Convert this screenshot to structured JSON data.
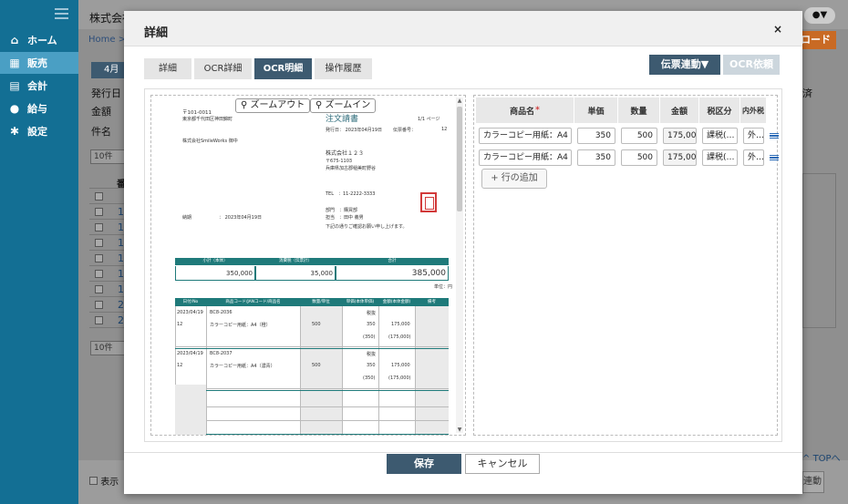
{
  "app": {
    "company": "株式会社",
    "breadcrumb_home": "Home",
    "breadcrumb_sep": ">",
    "download_label": "ロード",
    "user_caret": "▼",
    "sidebar": [
      {
        "icon": "home-icon",
        "label": "ホーム"
      },
      {
        "icon": "cart-icon",
        "label": "販売"
      },
      {
        "icon": "calculator-icon",
        "label": "会計"
      },
      {
        "icon": "money-bag-icon",
        "label": "給与"
      },
      {
        "icon": "gear-icon",
        "label": "設定"
      }
    ],
    "bg_tab": "4月",
    "bg_labels": [
      "発行日",
      "金額",
      "件名"
    ],
    "bg_page_size": "10件",
    "bg_status": "済",
    "bg_rows": [
      "",
      "1",
      "1",
      "1",
      "1",
      "1",
      "1",
      "2",
      "2"
    ],
    "bg_col_header": "番",
    "top_link": "TOPへ",
    "bg_show_label": "表示",
    "bg_right_button": "連動"
  },
  "modal": {
    "title": "詳細",
    "close": "×",
    "tabs": [
      "詳細",
      "OCR詳細",
      "OCR明細",
      "操作履歴"
    ],
    "active_tab": 2,
    "slip_button": "伝票連動▼",
    "ocr_button": "OCR依頼",
    "zoom_out": "ズームアウト",
    "zoom_in": "ズームイン",
    "save": "保存",
    "cancel": "キャンセル"
  },
  "document": {
    "postal": "〒101-0011",
    "address": "東京都千代田区神田錦町",
    "title": "注文請書",
    "page": "1/1 ページ",
    "issue_date": "発行日： 2023年04月19日",
    "slip_no_label": "伝票番号：",
    "slip_no": "12",
    "customer": "株式会社SmileWorks 御中",
    "supplier": "株式会社１２３",
    "supplier_postal": "〒675-1103",
    "supplier_address": "兵庫県加古郡稲美町野谷",
    "tel": "TEL　：11-2222-3333",
    "dept": "部門　：購買部",
    "staff": "担当　：田中 義男",
    "greeting": "下記の通りご確認お願い申し上げます。",
    "delivery_label": "納期",
    "delivery_date": "： 2023年04月19日",
    "sum_headers": [
      "小計（本体）",
      "消費税（伝票計）",
      "合計"
    ],
    "subtotal": "350,000",
    "tax": "35,000",
    "total": "385,000",
    "unit_note": "単位：円",
    "detail_headers": [
      "日付/No",
      "商品コード/JANコード/商品名",
      "数量/単位",
      "単価(本体単価)",
      "金額(本体金額)",
      "備考"
    ],
    "lines": [
      {
        "date": "2023/04/19",
        "code": "BC8-2036",
        "no": "12",
        "name": "カラーコピー用紙：A4（橙）",
        "qty": "500",
        "tax_label": "税抜",
        "price": "350",
        "amount": "175,000",
        "price2": "(350)",
        "amount2": "(175,000)"
      },
      {
        "date": "2023/04/19",
        "code": "BC8-2037",
        "no": "12",
        "name": "カラーコピー用紙：A4（濃青）",
        "qty": "500",
        "tax_label": "税抜",
        "price": "350",
        "amount": "175,000",
        "price2": "(350)",
        "amount2": "(175,000)"
      }
    ]
  },
  "table": {
    "headers": {
      "name": "商品名",
      "required": "*",
      "price": "単価",
      "qty": "数量",
      "amount": "金額",
      "tax": "税区分",
      "inout": "内外税"
    },
    "rows": [
      {
        "name": "カラーコピー用紙：A4（…",
        "price": "350",
        "qty": "500",
        "amount": "175,000",
        "tax": "課税(…",
        "inout": "外…"
      },
      {
        "name": "カラーコピー用紙：A4（…",
        "price": "350",
        "qty": "500",
        "amount": "175,000",
        "tax": "課税(…",
        "inout": "外…"
      }
    ],
    "add_row": "+ 行の追加"
  }
}
